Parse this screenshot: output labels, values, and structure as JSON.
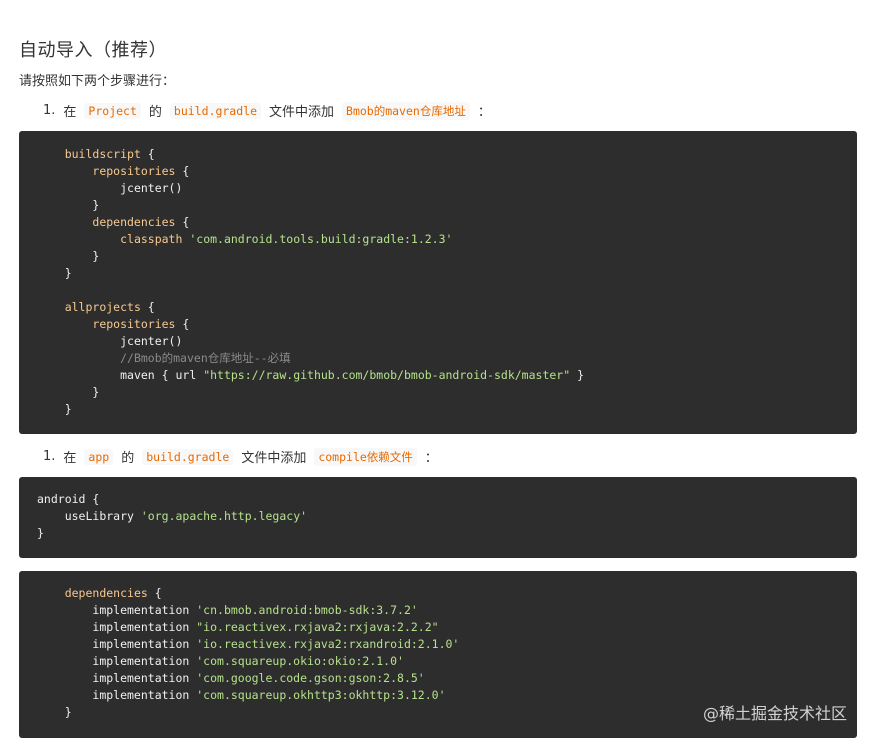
{
  "heading": "自动导入（推荐）",
  "subtext": "请按照如下两个步骤进行：",
  "step1": {
    "num": "1.",
    "t1": "在",
    "c1": "Project",
    "t2": "的",
    "c2": "build.gradle",
    "t3": "文件中添加",
    "c3": "Bmob的maven仓库地址",
    "t4": "："
  },
  "block1": [
    {
      "indent": "    ",
      "parts": [
        {
          "t": "kw",
          "v": "buildscript"
        },
        {
          "t": "pl",
          "v": " {"
        }
      ]
    },
    {
      "indent": "        ",
      "parts": [
        {
          "t": "kw",
          "v": "repositories"
        },
        {
          "t": "pl",
          "v": " {"
        }
      ]
    },
    {
      "indent": "            ",
      "parts": [
        {
          "t": "pl",
          "v": "jcenter()"
        }
      ]
    },
    {
      "indent": "        ",
      "parts": [
        {
          "t": "pl",
          "v": "}"
        }
      ]
    },
    {
      "indent": "        ",
      "parts": [
        {
          "t": "kw",
          "v": "dependencies"
        },
        {
          "t": "pl",
          "v": " {"
        }
      ]
    },
    {
      "indent": "            ",
      "parts": [
        {
          "t": "kw",
          "v": "classpath"
        },
        {
          "t": "pl",
          "v": " "
        },
        {
          "t": "str",
          "v": "'com.android.tools.build:gradle:1.2.3'"
        }
      ]
    },
    {
      "indent": "        ",
      "parts": [
        {
          "t": "pl",
          "v": "}"
        }
      ]
    },
    {
      "indent": "    ",
      "parts": [
        {
          "t": "pl",
          "v": "}"
        }
      ]
    },
    {
      "indent": "",
      "parts": []
    },
    {
      "indent": "    ",
      "parts": [
        {
          "t": "kw",
          "v": "allprojects"
        },
        {
          "t": "pl",
          "v": " {"
        }
      ]
    },
    {
      "indent": "        ",
      "parts": [
        {
          "t": "kw",
          "v": "repositories"
        },
        {
          "t": "pl",
          "v": " {"
        }
      ]
    },
    {
      "indent": "            ",
      "parts": [
        {
          "t": "pl",
          "v": "jcenter()"
        }
      ]
    },
    {
      "indent": "            ",
      "parts": [
        {
          "t": "cm",
          "v": "//Bmob的maven仓库地址--必填"
        }
      ]
    },
    {
      "indent": "            ",
      "parts": [
        {
          "t": "pl",
          "v": "maven { url "
        },
        {
          "t": "str",
          "v": "\"https://raw.github.com/bmob/bmob-android-sdk/master\""
        },
        {
          "t": "pl",
          "v": " }"
        }
      ]
    },
    {
      "indent": "        ",
      "parts": [
        {
          "t": "pl",
          "v": "}"
        }
      ]
    },
    {
      "indent": "    ",
      "parts": [
        {
          "t": "pl",
          "v": "}"
        }
      ]
    }
  ],
  "step2": {
    "num": "1.",
    "t1": "在",
    "c1": "app",
    "t2": "的",
    "c2": "build.gradle",
    "t3": "文件中添加",
    "c3": "compile依赖文件",
    "t4": "："
  },
  "block2": [
    {
      "indent": "",
      "parts": [
        {
          "t": "pl",
          "v": "android {"
        }
      ]
    },
    {
      "indent": "    ",
      "parts": [
        {
          "t": "pl",
          "v": "useLibrary "
        },
        {
          "t": "str",
          "v": "'org.apache.http.legacy'"
        }
      ]
    },
    {
      "indent": "",
      "parts": [
        {
          "t": "pl",
          "v": "}"
        }
      ]
    }
  ],
  "block3": [
    {
      "indent": "    ",
      "parts": [
        {
          "t": "kw",
          "v": "dependencies"
        },
        {
          "t": "pl",
          "v": " {"
        }
      ]
    },
    {
      "indent": "        ",
      "parts": [
        {
          "t": "pl",
          "v": "implementation "
        },
        {
          "t": "str",
          "v": "'cn.bmob.android:bmob-sdk:3.7.2'"
        }
      ]
    },
    {
      "indent": "        ",
      "parts": [
        {
          "t": "pl",
          "v": "implementation "
        },
        {
          "t": "str",
          "v": "\"io.reactivex.rxjava2:rxjava:2.2.2\""
        }
      ]
    },
    {
      "indent": "        ",
      "parts": [
        {
          "t": "pl",
          "v": "implementation "
        },
        {
          "t": "str",
          "v": "'io.reactivex.rxjava2:rxandroid:2.1.0'"
        }
      ]
    },
    {
      "indent": "        ",
      "parts": [
        {
          "t": "pl",
          "v": "implementation "
        },
        {
          "t": "str",
          "v": "'com.squareup.okio:okio:2.1.0'"
        }
      ]
    },
    {
      "indent": "        ",
      "parts": [
        {
          "t": "pl",
          "v": "implementation "
        },
        {
          "t": "str",
          "v": "'com.google.code.gson:gson:2.8.5'"
        }
      ]
    },
    {
      "indent": "        ",
      "parts": [
        {
          "t": "pl",
          "v": "implementation "
        },
        {
          "t": "str",
          "v": "'com.squareup.okhttp3:okhttp:3.12.0'"
        }
      ]
    },
    {
      "indent": "    ",
      "parts": [
        {
          "t": "pl",
          "v": "}"
        }
      ]
    }
  ],
  "watermark": "@稀土掘金技术社区",
  "colors": {
    "code_bg": "#2d2d2d",
    "keyword": "#f7c98f",
    "string": "#b5e18b",
    "comment": "#8a8a8a",
    "inline_code": "#e96900"
  }
}
